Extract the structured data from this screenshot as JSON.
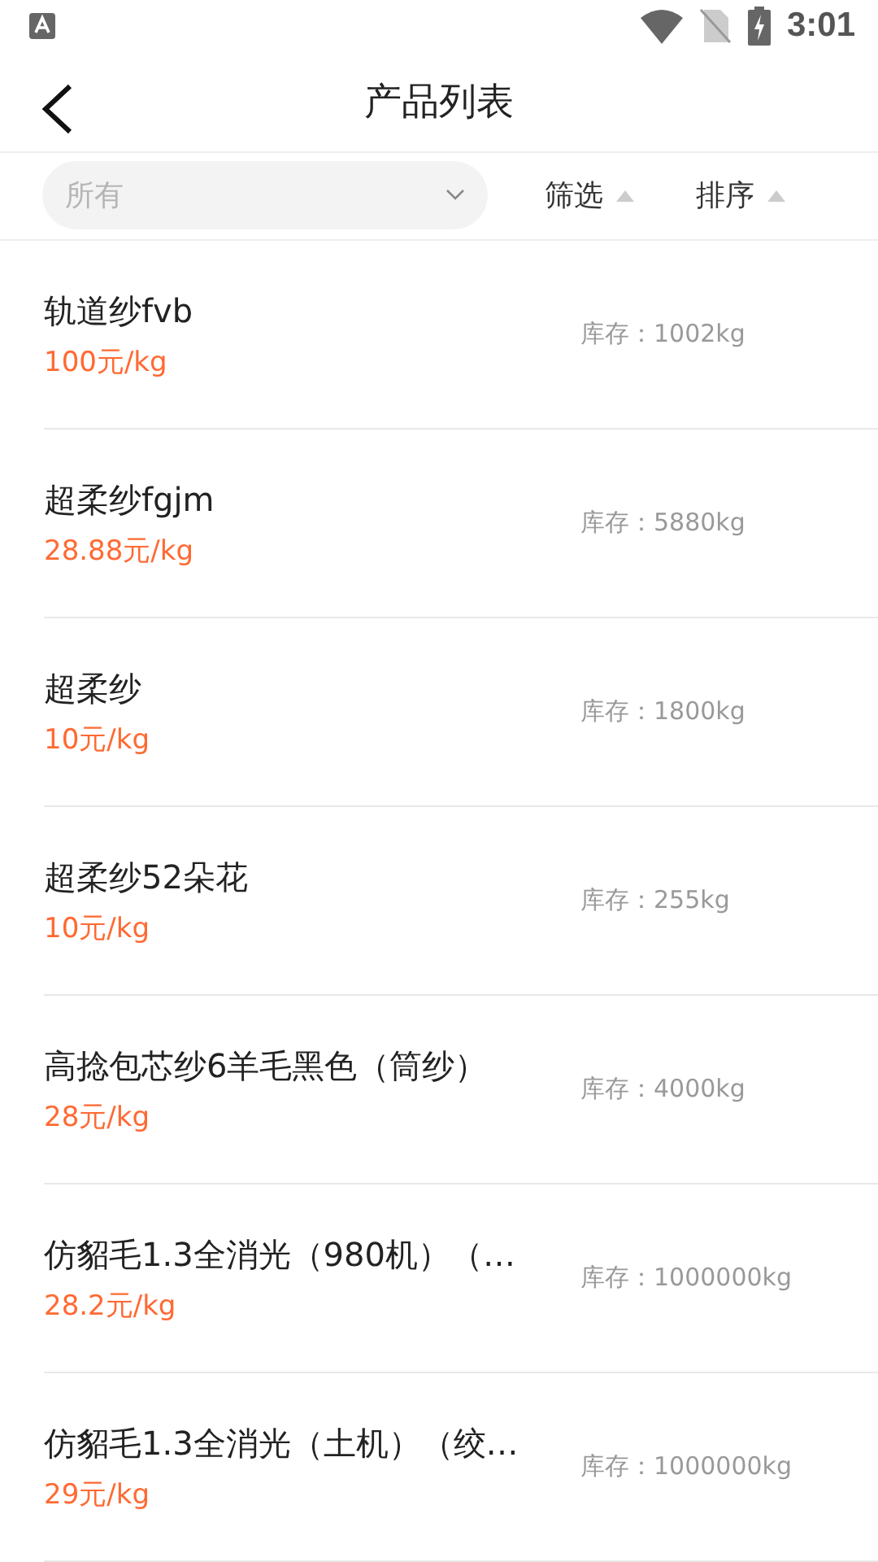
{
  "status_bar": {
    "time": "3:01"
  },
  "header": {
    "title": "产品列表"
  },
  "filter_bar": {
    "category": {
      "placeholder": "所有"
    },
    "controls": [
      {
        "label": "筛选"
      },
      {
        "label": "排序"
      }
    ]
  },
  "products": [
    {
      "name": "轨道纱fvb",
      "price": "100元/kg",
      "stock": "库存：1002kg"
    },
    {
      "name": "超柔纱fgjm",
      "price": "28.88元/kg",
      "stock": "库存：5880kg"
    },
    {
      "name": "超柔纱",
      "price": "10元/kg",
      "stock": "库存：1800kg"
    },
    {
      "name": "超柔纱52朵花",
      "price": "10元/kg",
      "stock": "库存：255kg"
    },
    {
      "name": "高捻包芯纱6羊毛黑色（筒纱）",
      "price": "28元/kg",
      "stock": "库存：4000kg"
    },
    {
      "name": "仿貂毛1.3全消光（980机）（…",
      "price": "28.2元/kg",
      "stock": "库存：1000000kg"
    },
    {
      "name": "仿貂毛1.3全消光（土机）（绞…",
      "price": "29元/kg",
      "stock": "库存：1000000kg"
    }
  ]
}
